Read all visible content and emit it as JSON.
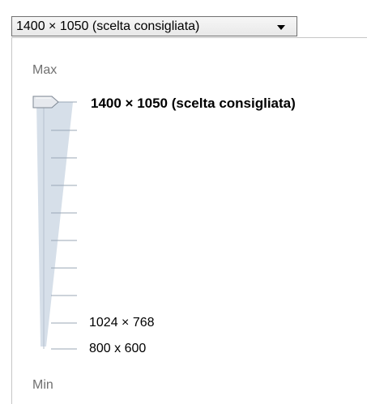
{
  "combo": {
    "value": "1400 × 1050 (scelta consigliata)",
    "icon": "chevron-down-icon"
  },
  "slider": {
    "max_label": "Max",
    "min_label": "Min",
    "tick_count": 10,
    "selected_label": "1400 × 1050 (scelta consigliata)",
    "labeled_ticks": [
      {
        "label": "1024 × 768"
      },
      {
        "label": "800 x 600"
      }
    ]
  },
  "colors": {
    "track_fill": "#d6dfe9",
    "tick": "#9aa7b6",
    "thumb": "#e6e9ee"
  }
}
